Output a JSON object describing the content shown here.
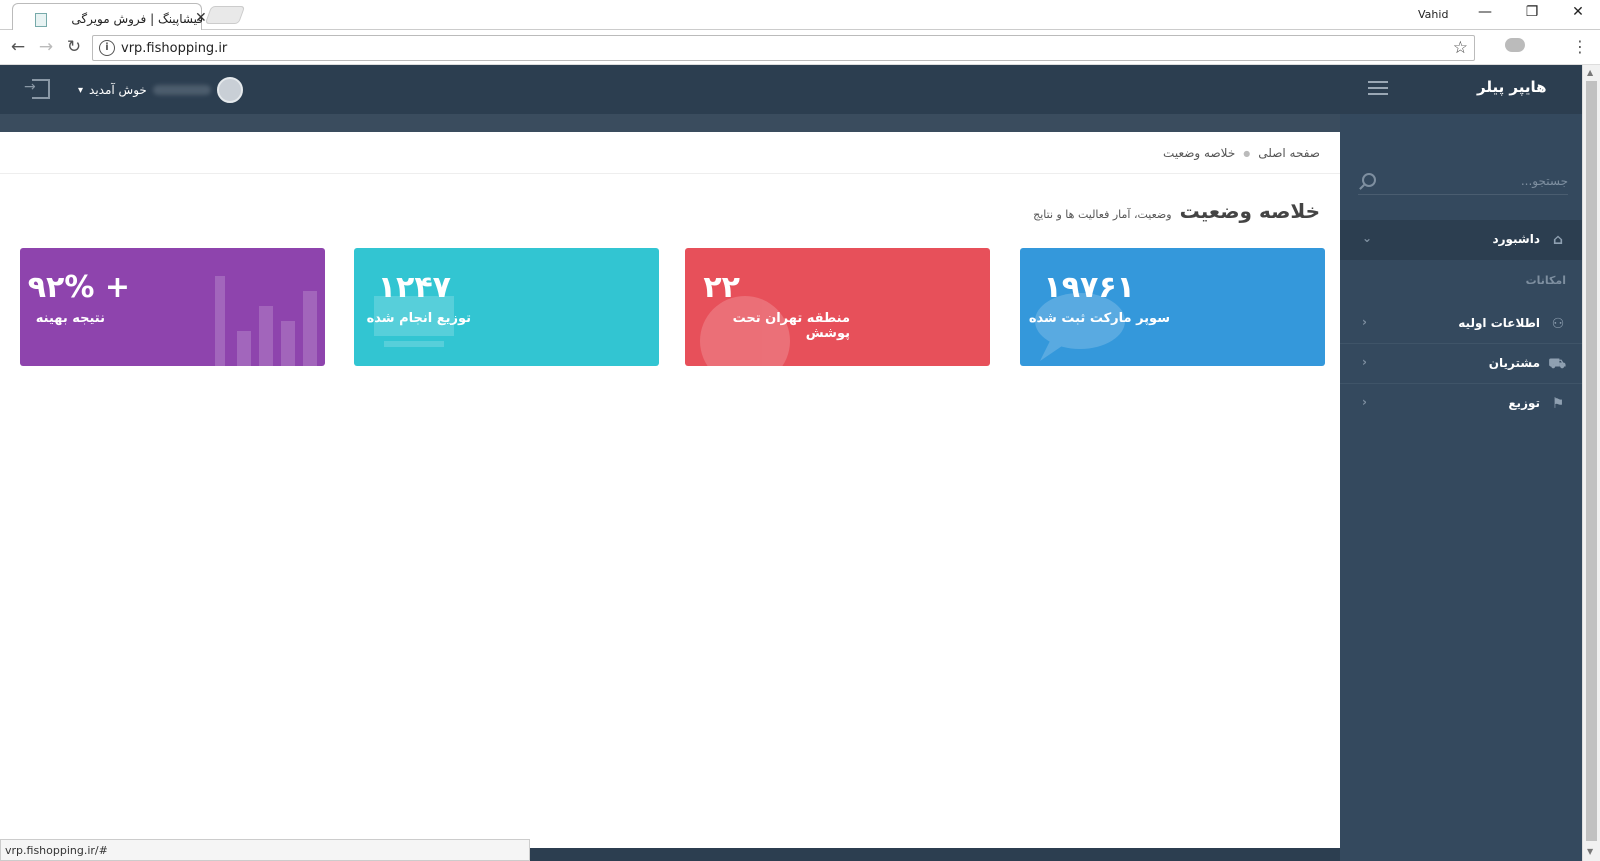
{
  "browser": {
    "tab_title": "فیشاپینگ | فروش مویرگی",
    "user": "Vahid",
    "url": "vrp.fishopping.ir",
    "status_url": "vrp.fishopping.ir/#"
  },
  "header": {
    "logo": "هایپر پیلر",
    "welcome": "خوش آمدید"
  },
  "breadcrumb": {
    "home": "صفحه اصلی",
    "current": "خلاصه وضعیت"
  },
  "page": {
    "title": "خلاصه وضعیت",
    "subtitle": "وضعیت، آمار فعالیت ها و نتایج"
  },
  "sidebar": {
    "search_placeholder": "جستجو...",
    "dashboard": "داشبورد",
    "section": "امکانات",
    "items": [
      {
        "label": "اطلاعات اولیه",
        "icon": "user-icon"
      },
      {
        "label": "مشتریان",
        "icon": "cart-icon"
      },
      {
        "label": "توزیع",
        "icon": "flag-icon"
      }
    ]
  },
  "stats": [
    {
      "value": "۱۹۷۶۱",
      "label": "سوپر مارکت ثبت شده",
      "color": "#3498db",
      "icon": "comments-icon"
    },
    {
      "value": "۲۲",
      "label": "منطقه تهران تحت پوشش",
      "color": "#e7505a",
      "icon": "globe-icon"
    },
    {
      "value": "۱۲۴۷",
      "label": "توزیع انجام شده",
      "color": "#32c5d2",
      "icon": "cart-icon"
    },
    {
      "value": "+ ۹۲%",
      "label": "نتیجه بهینه",
      "color": "#8e44ad",
      "icon": "bar-chart-icon"
    }
  ]
}
